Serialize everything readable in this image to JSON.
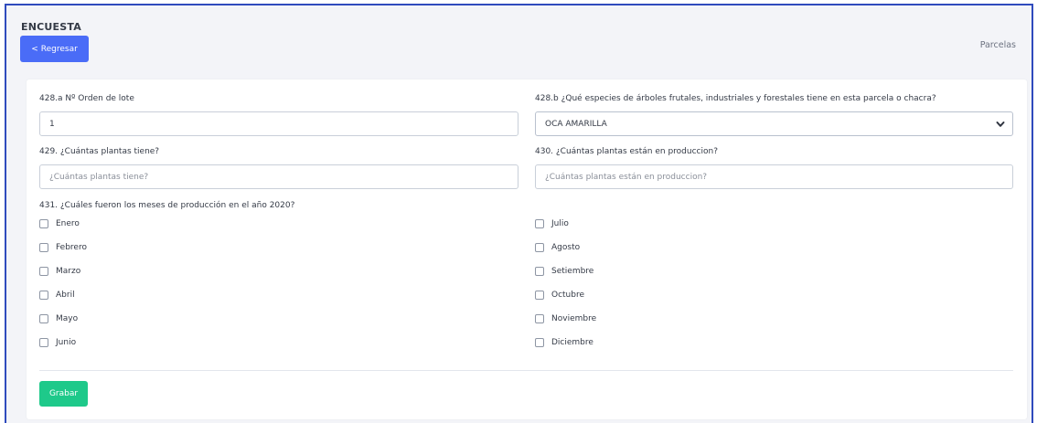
{
  "header": {
    "title": "ENCUESTA",
    "back_label": "Regresar",
    "breadcrumb": "Parcelas"
  },
  "form": {
    "q428a": {
      "label": "428.a Nº Orden de lote",
      "value": "1"
    },
    "q428b": {
      "label": "428.b ¿Qué especies de árboles frutales, industriales y forestales tiene en esta parcela o chacra?",
      "selected": "OCA AMARILLA"
    },
    "q429": {
      "label": "429. ¿Cuántas plantas tiene?",
      "placeholder": "¿Cuántas plantas tiene?"
    },
    "q430": {
      "label": "430. ¿Cuántas plantas están en produccion?",
      "placeholder": "¿Cuántas plantas están en produccion?"
    },
    "q431": {
      "label": "431. ¿Cuáles fueron los meses de producción en el año 2020?",
      "months_left": [
        "Enero",
        "Febrero",
        "Marzo",
        "Abril",
        "Mayo",
        "Junio"
      ],
      "months_right": [
        "Julio",
        "Agosto",
        "Setiembre",
        "Octubre",
        "Noviembre",
        "Diciembre"
      ]
    },
    "save_label": "Grabar"
  },
  "colors": {
    "accent": "#4a6cf7",
    "save": "#1ec98a",
    "frame": "#2f4bbd",
    "page_bg": "#f3f4f8"
  }
}
